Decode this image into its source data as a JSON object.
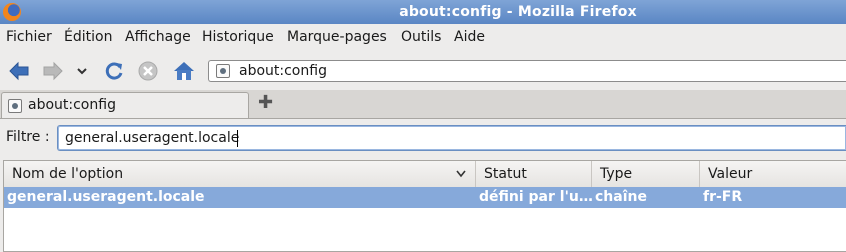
{
  "window": {
    "title": "about:config - Mozilla Firefox"
  },
  "menubar": {
    "items": [
      "Fichier",
      "Édition",
      "Affichage",
      "Historique",
      "Marque-pages",
      "Outils",
      "Aide"
    ]
  },
  "navbar": {
    "url": "about:config"
  },
  "tabs": [
    {
      "label": "about:config"
    }
  ],
  "filter": {
    "label": "Filtre :",
    "value": "general.useragent.locale"
  },
  "table": {
    "columns": [
      "Nom de l'option",
      "Statut",
      "Type",
      "Valeur"
    ],
    "rows": [
      {
        "name": "general.useragent.locale",
        "status": "défini par l'u…",
        "type": "chaîne",
        "value": "fr-FR"
      }
    ]
  },
  "colors": {
    "titlebar": "#6b93cc",
    "selection": "#86a9da"
  }
}
